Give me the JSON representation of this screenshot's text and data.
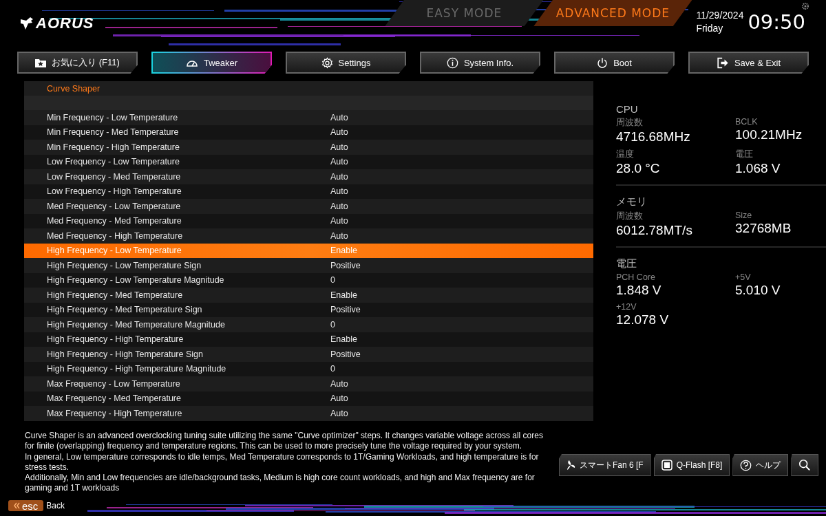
{
  "logo": {
    "text": "AORUS"
  },
  "modes": [
    {
      "label": "EASY MODE",
      "selected": false
    },
    {
      "label": "ADVANCED MODE",
      "selected": true
    }
  ],
  "clock": {
    "date": "11/29/2024",
    "day": "Friday",
    "time": "09:50"
  },
  "tabs": [
    {
      "label": "お気に入り (F11)",
      "selected": false
    },
    {
      "label": "Tweaker",
      "selected": true
    },
    {
      "label": "Settings",
      "selected": false
    },
    {
      "label": "System Info.",
      "selected": false
    },
    {
      "label": "Boot",
      "selected": false
    },
    {
      "label": "Save & Exit",
      "selected": false
    }
  ],
  "settings": {
    "title": "Curve Shaper",
    "rows": [
      {
        "name": "Min Frequency - Low Temperature",
        "value": "Auto",
        "selected": false
      },
      {
        "name": "Min Frequency - Med Temperature",
        "value": "Auto",
        "selected": false
      },
      {
        "name": "Min Frequency - High Temperature",
        "value": "Auto",
        "selected": false
      },
      {
        "name": "Low Frequency - Low Temperature",
        "value": "Auto",
        "selected": false
      },
      {
        "name": "Low Frequency - Med Temperature",
        "value": "Auto",
        "selected": false
      },
      {
        "name": "Low Frequency - High Temperature",
        "value": "Auto",
        "selected": false
      },
      {
        "name": "Med Frequency - Low Temperature",
        "value": "Auto",
        "selected": false
      },
      {
        "name": "Med Frequency - Med Temperature",
        "value": "Auto",
        "selected": false
      },
      {
        "name": "Med Frequency - High Temperature",
        "value": "Auto",
        "selected": false
      },
      {
        "name": "High Frequency - Low Temperature",
        "value": "Enable",
        "selected": true
      },
      {
        "name": "High Frequency - Low Temperature Sign",
        "value": "Positive",
        "selected": false
      },
      {
        "name": "High Frequency - Low Temperature Magnitude",
        "value": "0",
        "selected": false
      },
      {
        "name": "High Frequency - Med Temperature",
        "value": "Enable",
        "selected": false
      },
      {
        "name": "High Frequency - Med Temperature Sign",
        "value": "Positive",
        "selected": false
      },
      {
        "name": "High Frequency - Med Temperature Magnitude",
        "value": "0",
        "selected": false
      },
      {
        "name": "High Frequency - High Temperature",
        "value": "Enable",
        "selected": false
      },
      {
        "name": "High Frequency - High Temperature Sign",
        "value": "Positive",
        "selected": false
      },
      {
        "name": "High Frequency - High Temperature Magnitude",
        "value": "0",
        "selected": false
      },
      {
        "name": "Max Frequency - Low Temperature",
        "value": "Auto",
        "selected": false
      },
      {
        "name": "Max Frequency - Med Temperature",
        "value": "Auto",
        "selected": false
      },
      {
        "name": "Max Frequency - High Temperature",
        "value": "Auto",
        "selected": false
      }
    ]
  },
  "monitor": [
    {
      "title": "CPU",
      "items": [
        {
          "label": "周波数",
          "value": "4716.68MHz"
        },
        {
          "label": "BCLK",
          "value": "100.21MHz"
        },
        {
          "label": "温度",
          "value": "28.0 °C"
        },
        {
          "label": "電圧",
          "value": "1.068 V"
        }
      ]
    },
    {
      "title": "メモリ",
      "items": [
        {
          "label": "周波数",
          "value": "6012.78MT/s"
        },
        {
          "label": "Size",
          "value": "32768MB"
        }
      ]
    },
    {
      "title": "電圧",
      "items": [
        {
          "label": "PCH Core",
          "value": "1.848 V"
        },
        {
          "label": "+5V",
          "value": "5.010 V"
        },
        {
          "label": "+12V",
          "value": "12.078 V"
        }
      ]
    }
  ],
  "description": [
    "Curve Shaper is an advanced overclocking tuning suite utilizing the same \"Curve optimizer\" steps. It changes variable voltage across all cores for finite (overlapping) frequency and temperature regions. This can be used to more precisely tune the voltage required by your system.",
    "In general, Low temperature corresponds to idle temps, Med Temperature corresponds to 1T/Gaming Workloads, and high temperature is for stress tests.",
    "Additionally, Min and Low frequencies are idle/background tasks, Medium is high core count workloads, and high and Max frequency are for gaming and 1T workloads"
  ],
  "tools": [
    {
      "kind": "fan",
      "label": "スマートFan 6 [F"
    },
    {
      "kind": "flash",
      "label": "Q-Flash [F8]"
    },
    {
      "kind": "help",
      "label": "ヘルプ"
    },
    {
      "kind": "search"
    }
  ],
  "esc": {
    "key": "esc",
    "label": "Back"
  }
}
